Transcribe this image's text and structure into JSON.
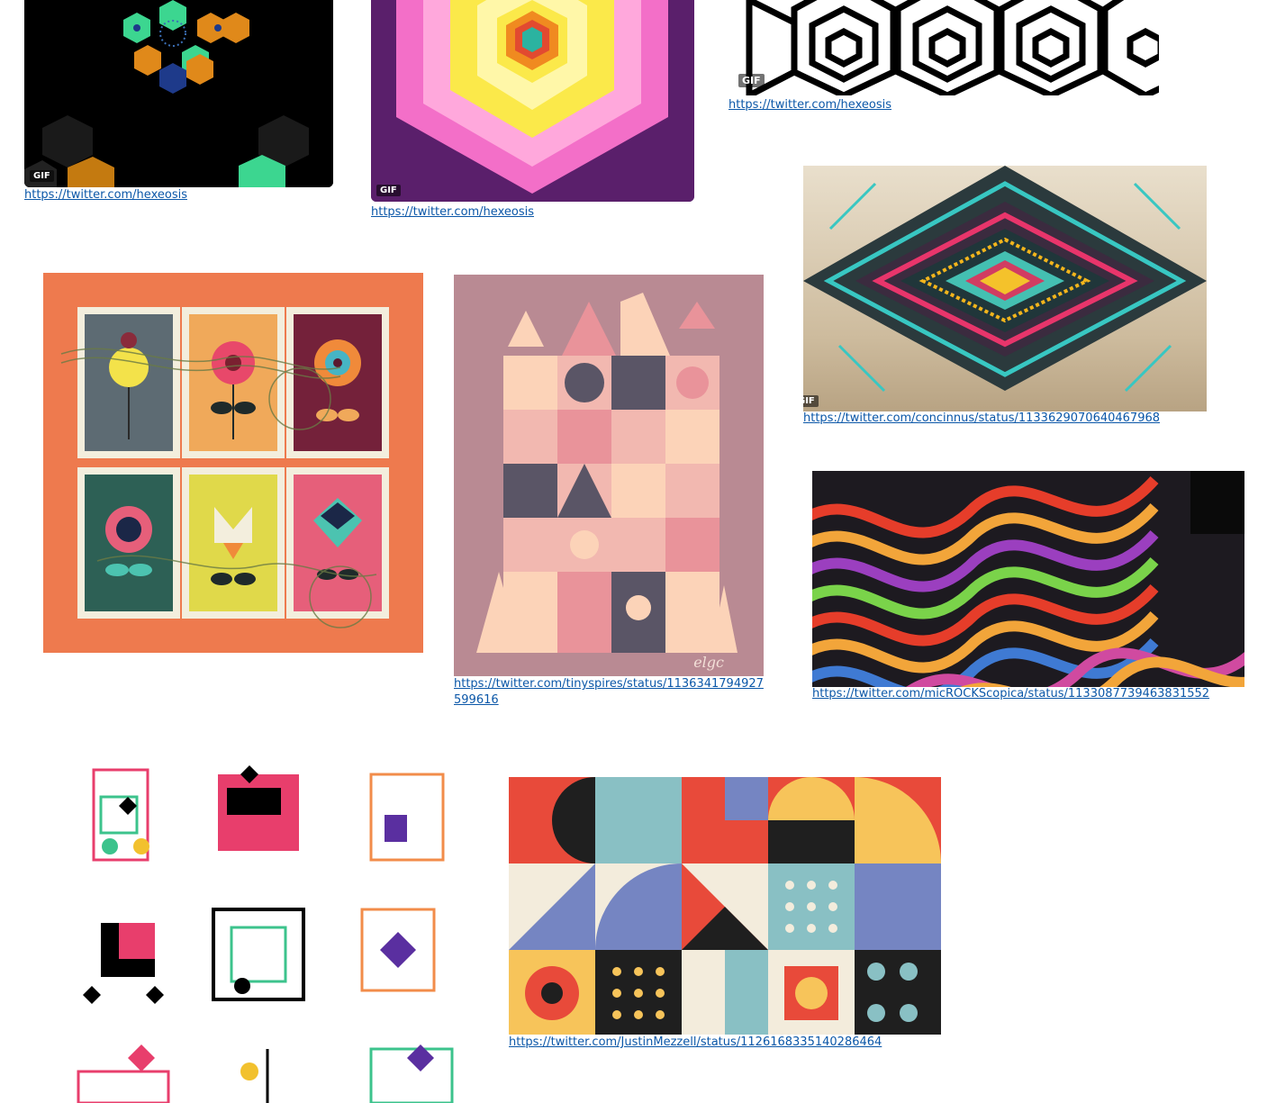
{
  "gif_badge": "GIF",
  "tiles": [
    {
      "link": "https://twitter.com/hexeosis",
      "description": "black background with teal, orange and blue hexagon flower pattern"
    },
    {
      "link": "https://twitter.com/hexeosis",
      "description": "concentric hexagons purple, pink, yellow, orange, teal"
    },
    {
      "link": "https://twitter.com/hexeosis",
      "description": "black and white isometric cube op-art pattern"
    },
    {
      "link": "https://twitter.com/concinnus/status/1133629070640467968",
      "description": "symmetric teal and pink geometric diamond on beige"
    },
    {
      "link": "",
      "description": "six flower postage stamps on orange background"
    },
    {
      "link": "https://twitter.com/tinyspires/status/1136341794927599616",
      "description": "pink geometric castle illustration"
    },
    {
      "link": "https://twitter.com/micROCKScopica/status/1133087739463831552",
      "description": "colorful striped rock microscopy waves"
    },
    {
      "link": "",
      "description": "grid of small colorful geometric glyph symbols"
    },
    {
      "link": "https://twitter.com/JustinMezzell/status/1126168335140286464",
      "description": "Bauhaus style geometric tile grid"
    }
  ],
  "colors": {
    "link": "#0b57a8",
    "stamp_bg": "#ee7a4e",
    "castle_bg": "#b98a93",
    "hex_purple": "#5a1f6b",
    "hex_pink": "#f36fc8",
    "hex_yellow": "#fbe94a"
  }
}
